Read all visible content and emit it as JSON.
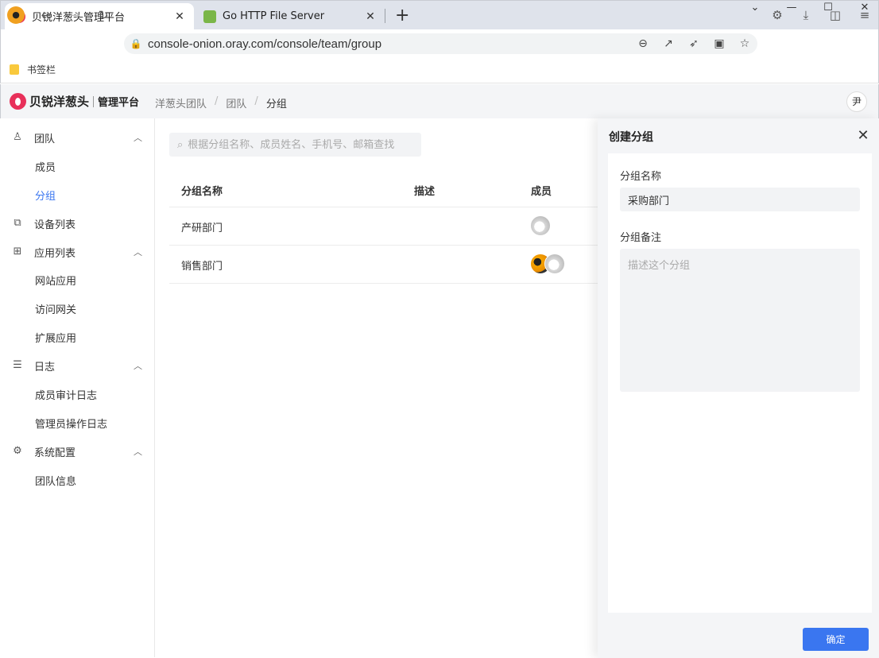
{
  "browser": {
    "tabs": [
      {
        "title": "贝锐洋葱头管理平台",
        "active": true,
        "favicon_color": "#e8305a"
      },
      {
        "title": "Go HTTP File Server",
        "active": false,
        "favicon_color": "#7ab648"
      }
    ],
    "url": "console-onion.oray.com/console/team/group",
    "bookmarks_bar": {
      "label": "书签栏"
    }
  },
  "app": {
    "brand": "贝锐洋葱头",
    "subtitle": "管理平台",
    "breadcrumb": [
      "洋葱头团队",
      "团队",
      "分组"
    ],
    "user_initial": "尹"
  },
  "sidebar": {
    "groups": [
      {
        "label": "团队",
        "icon": "team-icon",
        "items": [
          "成员",
          "分组"
        ]
      },
      {
        "label": "设备列表",
        "icon": "devices-icon",
        "items": []
      },
      {
        "label": "应用列表",
        "icon": "apps-icon",
        "items": [
          "网站应用",
          "访问网关",
          "扩展应用"
        ]
      },
      {
        "label": "日志",
        "icon": "log-icon",
        "items": [
          "成员审计日志",
          "管理员操作日志"
        ]
      },
      {
        "label": "系统配置",
        "icon": "settings-icon",
        "items": [
          "团队信息"
        ]
      }
    ],
    "active_item": "分组"
  },
  "main": {
    "search_placeholder": "根据分组名称、成员姓名、手机号、邮箱查找",
    "columns": [
      "分组名称",
      "描述",
      "成员"
    ],
    "rows": [
      {
        "name": "产研部门",
        "description": "",
        "members": [
          "koala"
        ]
      },
      {
        "name": "销售部门",
        "description": "",
        "members": [
          "panda",
          "koala"
        ]
      }
    ]
  },
  "drawer": {
    "title": "创建分组",
    "name_label": "分组名称",
    "name_value": "采购部门",
    "remark_label": "分组备注",
    "remark_placeholder": "描述这个分组",
    "confirm_label": "确定"
  },
  "colors": {
    "accent": "#3a76f0",
    "brand": "#e8305a"
  }
}
